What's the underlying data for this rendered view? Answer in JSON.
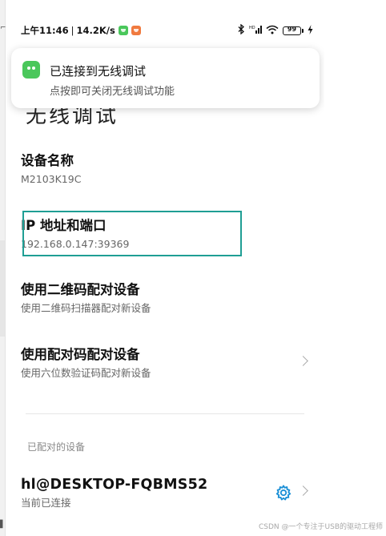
{
  "status_bar": {
    "time": "上午11:46",
    "separator": "|",
    "speed": "14.2K/s",
    "battery_text": "99",
    "battery_level": 0.99,
    "hd_label": "HD"
  },
  "notification": {
    "title": "已连接到无线调试",
    "body": "点按即可关闭无线调试功能"
  },
  "page": {
    "heading": "无线调试"
  },
  "items": {
    "device_name": {
      "title": "设备名称",
      "value": "M2103K19C"
    },
    "ip_port": {
      "title": "IP 地址和端口",
      "value": "192.168.0.147:39369"
    },
    "qr_pair": {
      "title": "使用二维码配对设备",
      "subtitle": "使用二维码扫描器配对新设备"
    },
    "code_pair": {
      "title": "使用配对码配对设备",
      "subtitle": "使用六位数验证码配对新设备"
    }
  },
  "paired_section": {
    "header": "已配对的设备",
    "device": {
      "name": "hl@DESKTOP-FQBMS52",
      "status": "当前已连接"
    }
  },
  "watermark": "CSDN @一个专注于USB的驱动工程师",
  "colors": {
    "highlight_border": "#1f9e94",
    "accent_gear": "#1b8fd6",
    "app_green": "#4ac75b",
    "app_orange": "#f07a3f"
  }
}
